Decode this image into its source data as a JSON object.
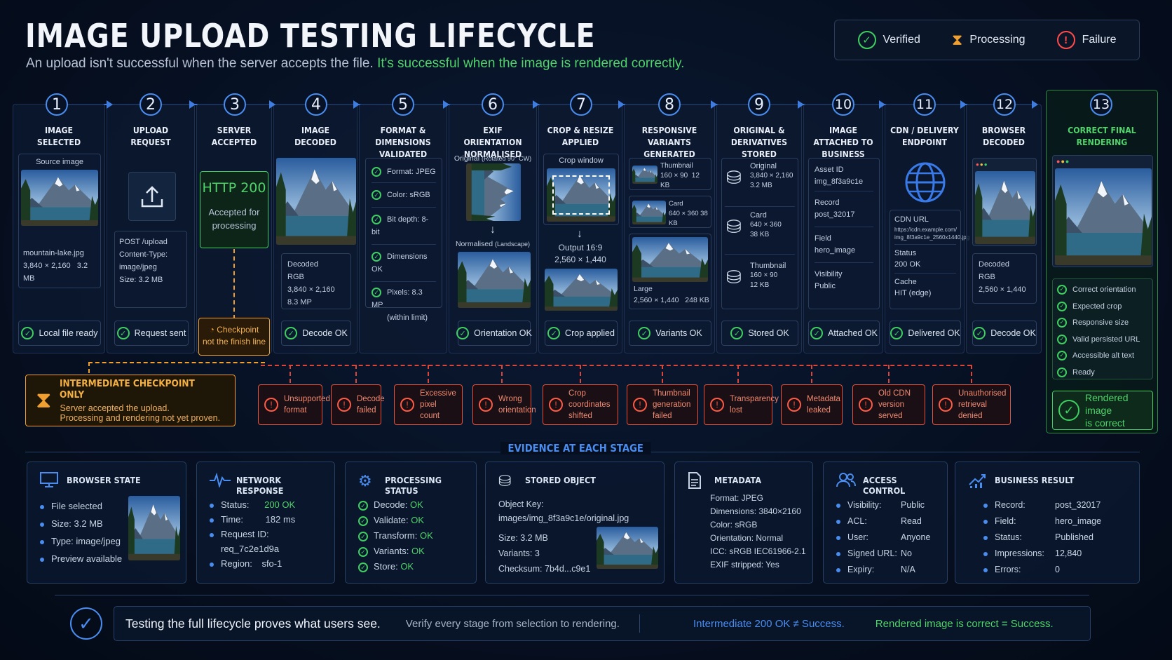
{
  "header": {
    "title": "IMAGE UPLOAD TESTING LIFECYCLE",
    "subtitle_plain": "An upload isn't successful when the server accepts the file.",
    "subtitle_highlight": "It's successful when the image is rendered correctly."
  },
  "legend": {
    "verified": "Verified",
    "processing": "Processing",
    "failure": "Failure"
  },
  "colors": {
    "success": "#3fcf60",
    "failure": "#ff4b4b",
    "accent": "#4a8df0",
    "checkpoint": "#f0a030"
  },
  "stages": [
    {
      "num": "1",
      "title1": "IMAGE",
      "title2": "SELECTED",
      "panel_label": "Source image",
      "file": "mountain-lake.jpg",
      "dims": "3,840 × 2,160",
      "size": "3.2 MB",
      "status": "Local file ready"
    },
    {
      "num": "2",
      "title1": "UPLOAD",
      "title2": "REQUEST",
      "req1": "POST /upload",
      "req2": "Content-Type:",
      "req3": "image/jpeg",
      "req4": "Size: 3.2 MB",
      "status": "Request sent"
    },
    {
      "num": "3",
      "title1": "SERVER",
      "title2": "ACCEPTED",
      "http": "HTTP 200",
      "accepted1": "Accepted for",
      "accepted2": "processing",
      "status1": "Checkpoint",
      "status2": "not the finish line"
    },
    {
      "num": "4",
      "title1": "IMAGE",
      "title2": "DECODED",
      "d1": "Decoded",
      "d2": "RGB",
      "d3": "3,840 × 2,160",
      "d4": "8.3 MP",
      "status": "Decode OK"
    },
    {
      "num": "5",
      "title1": "FORMAT & DIMENSIONS",
      "title2": "VALIDATED",
      "checks": [
        "Format: JPEG",
        "Color: sRGB",
        "Bit depth: 8-bit",
        "Dimensions OK",
        "Pixels: 8.3 MP"
      ],
      "pixels_note": "(within limit)"
    },
    {
      "num": "6",
      "title1": "EXIF ORIENTATION",
      "title2": "NORMALISED",
      "orig": "Original",
      "orig_note": "(Rotated 90° CW)",
      "norm": "Normalised",
      "norm_note": "(Landscape)",
      "status": "Orientation OK"
    },
    {
      "num": "7",
      "title1": "CROP & RESIZE",
      "title2": "APPLIED",
      "crop": "Crop window",
      "out1": "Output 16:9",
      "out2": "2,560 × 1,440",
      "status": "Crop applied"
    },
    {
      "num": "8",
      "title1": "RESPONSIVE",
      "title2": "VARIANTS GENERATED",
      "v1": "Thumbnail",
      "v1d": "160 × 90",
      "v1s": "12 KB",
      "v2": "Card",
      "v2d": "640 × 360",
      "v2s": "38 KB",
      "v3": "Large",
      "v3d": "2,560 × 1,440",
      "v3s": "248 KB",
      "status": "Variants OK"
    },
    {
      "num": "9",
      "title1": "ORIGINAL &",
      "title2": "DERIVATIVES STORED",
      "s1": "Original",
      "s1d": "3,840 × 2,160",
      "s1s": "3.2 MB",
      "s2": "Card",
      "s2d": "640 × 360",
      "s2s": "38 KB",
      "s3": "Thumbnail",
      "s3d": "160 × 90",
      "s3s": "12 KB",
      "status": "Stored OK"
    },
    {
      "num": "10",
      "title1": "IMAGE ATTACHED TO",
      "title2": "BUSINESS RECORD",
      "r1k": "Asset ID",
      "r1v": "img_8f3a9c1e",
      "r2k": "Record",
      "r2v": "post_32017",
      "r3k": "Field",
      "r3v": "hero_image",
      "r4k": "Visibility",
      "r4v": "Public",
      "status": "Attached OK"
    },
    {
      "num": "11",
      "title1": "CDN / DELIVERY",
      "title2": "ENDPOINT",
      "cdn": "CDN URL",
      "cdn_url1": "https://cdn.example.com/",
      "cdn_url2": "img_8f3a9c1e_2560x1440.jpg",
      "st": "Status",
      "stv": "200 OK",
      "cache": "Cache",
      "cachev": "HIT (edge)",
      "status": "Delivered OK"
    },
    {
      "num": "12",
      "title1": "BROWSER",
      "title2": "DECODED",
      "d1": "Decoded",
      "d2": "RGB",
      "d3": "2,560 × 1,440",
      "status": "Decode OK"
    },
    {
      "num": "13",
      "title1": "CORRECT FINAL",
      "title2": "RENDERING",
      "checks": [
        "Correct orientation",
        "Expected crop",
        "Responsive size",
        "Valid persisted URL",
        "Accessible alt text",
        "Ready"
      ],
      "final1": "Rendered image",
      "final2": "is correct"
    }
  ],
  "checkpoint": {
    "title": "INTERMEDIATE CHECKPOINT ONLY",
    "line1": "Server accepted the upload.",
    "line2": "Processing and rendering not yet proven."
  },
  "failures": [
    {
      "l1": "Unsupported",
      "l2": "format"
    },
    {
      "l1": "Decode",
      "l2": "failed"
    },
    {
      "l1": "Excessive",
      "l2": "pixel count"
    },
    {
      "l1": "Wrong",
      "l2": "orientation"
    },
    {
      "l1": "Crop coordinates",
      "l2": "shifted"
    },
    {
      "l1": "Thumbnail",
      "l2": "generation failed"
    },
    {
      "l1": "Transparency",
      "l2": "lost"
    },
    {
      "l1": "Metadata",
      "l2": "leaked"
    },
    {
      "l1": "Old CDN version",
      "l2": "served"
    },
    {
      "l1": "Unauthorised",
      "l2": "retrieval denied"
    }
  ],
  "evidence_heading": "EVIDENCE AT EACH STAGE",
  "evidence": {
    "browser": {
      "title": "BROWSER STATE",
      "items": [
        "File selected",
        "Size: 3.2 MB",
        "Type: image/jpeg",
        "Preview available"
      ]
    },
    "network": {
      "title": "NETWORK RESPONSE",
      "status_k": "Status:",
      "status_v": "200 OK",
      "time_k": "Time:",
      "time_v": "182 ms",
      "req_k": "Request ID:",
      "req_v": "req_7c2e1d9a",
      "region_k": "Region:",
      "region_v": "sfo-1"
    },
    "processing": {
      "title": "PROCESSING STATUS",
      "items": [
        {
          "k": "Decode:",
          "v": "OK"
        },
        {
          "k": "Validate:",
          "v": "OK"
        },
        {
          "k": "Transform:",
          "v": "OK"
        },
        {
          "k": "Variants:",
          "v": "OK"
        },
        {
          "k": "Store:",
          "v": "OK"
        }
      ]
    },
    "stored": {
      "title": "STORED OBJECT",
      "key_k": "Object Key:",
      "key_v": "images/img_8f3a9c1e/original.jpg",
      "size": "Size:  3.2 MB",
      "variants": "Variants:  3",
      "checksum": "Checksum:  7b4d...c9e1"
    },
    "metadata": {
      "title": "METADATA",
      "items": [
        "Format: JPEG",
        "Dimensions: 3840×2160",
        "Color: sRGB",
        "Orientation: Normal",
        "ICC: sRGB IEC61966-2.1",
        "EXIF stripped:  Yes"
      ]
    },
    "access": {
      "title": "ACCESS CONTROL",
      "rows": [
        {
          "k": "Visibility:",
          "v": "Public"
        },
        {
          "k": "ACL:",
          "v": "Read"
        },
        {
          "k": "User:",
          "v": "Anyone"
        },
        {
          "k": "Signed URL:",
          "v": "No"
        },
        {
          "k": "Expiry:",
          "v": "N/A"
        }
      ]
    },
    "business": {
      "title": "BUSINESS RESULT",
      "rows": [
        {
          "k": "Record:",
          "v": "post_32017"
        },
        {
          "k": "Field:",
          "v": "hero_image"
        },
        {
          "k": "Status:",
          "v": "Published"
        },
        {
          "k": "Impressions:",
          "v": "12,840"
        },
        {
          "k": "Errors:",
          "v": "0"
        }
      ]
    }
  },
  "footer": {
    "main": "Testing the full lifecycle proves what users see.",
    "sub": "Verify every stage from selection to rendering.",
    "blue": "Intermediate 200 OK  ≠  Success.",
    "green": "Rendered image is correct  =  Success."
  }
}
